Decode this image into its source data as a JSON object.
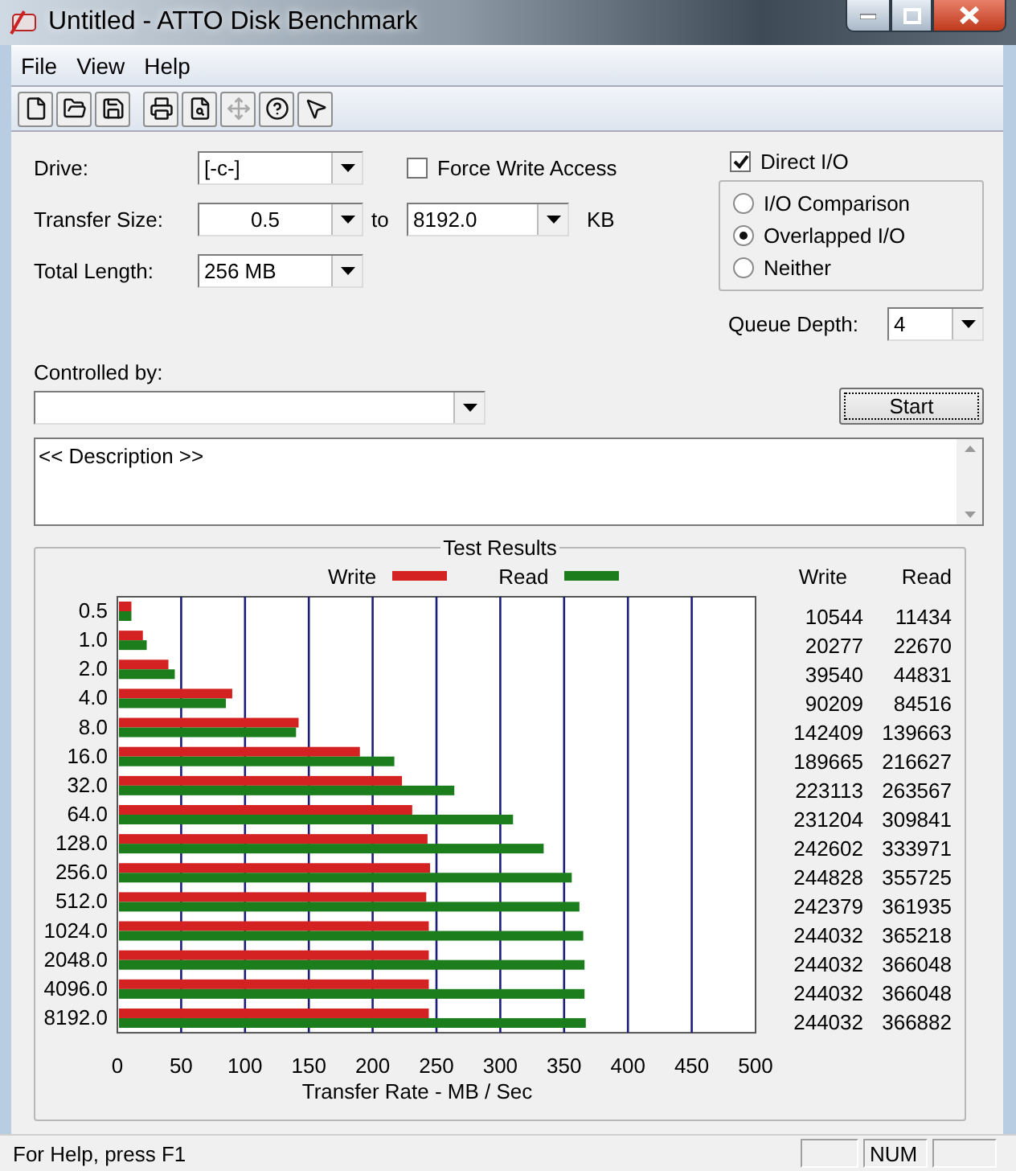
{
  "window": {
    "title": "Untitled - ATTO Disk Benchmark"
  },
  "menu": [
    {
      "label": "File"
    },
    {
      "label": "View"
    },
    {
      "label": "Help"
    }
  ],
  "toolbar": [
    {
      "kind": "new",
      "disabled": false
    },
    {
      "kind": "open",
      "disabled": false
    },
    {
      "kind": "save",
      "disabled": false
    },
    {
      "kind": "print",
      "disabled": false
    },
    {
      "kind": "preview",
      "disabled": false
    },
    {
      "kind": "move",
      "disabled": true
    },
    {
      "kind": "help",
      "disabled": false
    },
    {
      "kind": "context_help",
      "disabled": false
    }
  ],
  "drive": {
    "label": "Drive:",
    "value": "[-c-]"
  },
  "force_write_access": {
    "label": "Force Write Access",
    "checked": false
  },
  "direct_io": {
    "label": "Direct I/O",
    "checked": true
  },
  "transfer_size": {
    "label": "Transfer Size:",
    "from": "0.5",
    "to_label": "to",
    "to": "8192.0",
    "unit": "KB"
  },
  "total_length": {
    "label": "Total Length:",
    "value": "256 MB"
  },
  "io_mode": [
    {
      "label": "I/O Comparison",
      "selected": false
    },
    {
      "label": "Overlapped I/O",
      "selected": true
    },
    {
      "label": "Neither",
      "selected": false
    }
  ],
  "queue_depth": {
    "label": "Queue Depth:",
    "value": "4"
  },
  "controlled_by": {
    "label": "Controlled by:"
  },
  "start_button": "Start",
  "description": "<< Description >>",
  "test_results": {
    "title": "Test Results",
    "columns": [
      "Write",
      "Read"
    ],
    "rows": [
      {
        "write": "10544",
        "read": "11434"
      },
      {
        "write": "20277",
        "read": "22670"
      },
      {
        "write": "39540",
        "read": "44831"
      },
      {
        "write": "90209",
        "read": "84516"
      },
      {
        "write": "142409",
        "read": "139663"
      },
      {
        "write": "189665",
        "read": "216627"
      },
      {
        "write": "223113",
        "read": "263567"
      },
      {
        "write": "231204",
        "read": "309841"
      },
      {
        "write": "242602",
        "read": "333971"
      },
      {
        "write": "244828",
        "read": "355725"
      },
      {
        "write": "242379",
        "read": "361935"
      },
      {
        "write": "244032",
        "read": "365218"
      },
      {
        "write": "244032",
        "read": "366048"
      },
      {
        "write": "244032",
        "read": "366048"
      },
      {
        "write": "244032",
        "read": "366882"
      }
    ],
    "chart_data": {
      "type": "bar",
      "orientation": "horizontal",
      "xlabel": "Transfer Rate - MB / Sec",
      "categories": [
        "0.5",
        "1.0",
        "2.0",
        "4.0",
        "8.0",
        "16.0",
        "32.0",
        "64.0",
        "128.0",
        "256.0",
        "512.0",
        "1024.0",
        "2048.0",
        "4096.0",
        "8192.0"
      ],
      "series": [
        {
          "name": "Write",
          "color": "#d42222",
          "values": [
            11,
            20,
            40,
            90,
            142,
            190,
            223,
            231,
            243,
            245,
            242,
            244,
            244,
            244,
            244
          ]
        },
        {
          "name": "Read",
          "color": "#1b7d1b",
          "values": [
            11,
            23,
            45,
            85,
            140,
            217,
            264,
            310,
            334,
            356,
            362,
            365,
            366,
            366,
            367
          ]
        }
      ],
      "grid": true,
      "xlim": [
        0,
        500
      ],
      "xticks": [
        0,
        50,
        100,
        150,
        200,
        250,
        300,
        350,
        400,
        450,
        500
      ]
    }
  },
  "status_bar": {
    "text": "For Help, press F1",
    "indicators": [
      "NUM"
    ]
  }
}
